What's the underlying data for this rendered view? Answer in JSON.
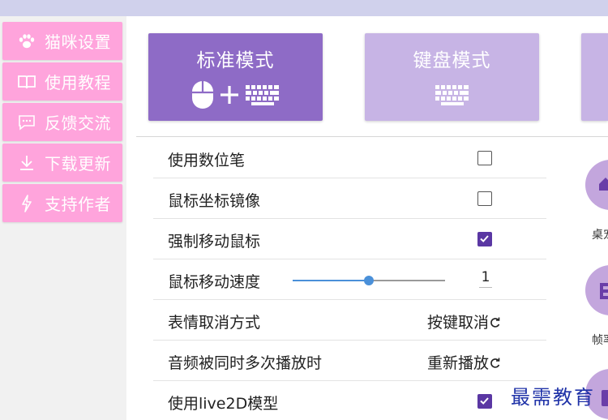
{
  "sidebar": {
    "items": [
      {
        "label": "猫咪设置",
        "icon": "paw-icon"
      },
      {
        "label": "使用教程",
        "icon": "book-icon"
      },
      {
        "label": "反馈交流",
        "icon": "chat-icon"
      },
      {
        "label": "下载更新",
        "icon": "download-icon"
      },
      {
        "label": "支持作者",
        "icon": "bolt-icon"
      }
    ]
  },
  "modes": [
    {
      "label": "标准模式",
      "selected": true,
      "icons": [
        "mouse-icon",
        "plus-icon",
        "keyboard-icon"
      ]
    },
    {
      "label": "键盘模式",
      "selected": false,
      "icons": [
        "keyboard-icon"
      ]
    },
    {
      "label": "",
      "selected": false,
      "icons": []
    }
  ],
  "settings": [
    {
      "label": "使用数位笔",
      "type": "checkbox",
      "checked": false
    },
    {
      "label": "鼠标坐标镜像",
      "type": "checkbox",
      "checked": false
    },
    {
      "label": "强制移动鼠标",
      "type": "checkbox",
      "checked": true
    },
    {
      "label": "鼠标移动速度",
      "type": "slider",
      "value": "1",
      "fraction": 0.5
    },
    {
      "label": "表情取消方式",
      "type": "cycle",
      "value": "按键取消"
    },
    {
      "label": "音频被同时多次播放时",
      "type": "cycle",
      "value": "重新播放"
    },
    {
      "label": "使用live2D模型",
      "type": "checkbox",
      "checked": true
    }
  ],
  "right_panel": [
    {
      "label": "桌宠",
      "icon": "home-icon"
    },
    {
      "label": "帧率",
      "icon": "grid-icon"
    },
    {
      "label": "",
      "icon": "partial-icon"
    }
  ],
  "watermark": "最需教育",
  "colors": {
    "topbar": "#d0d1ec",
    "sidebar_item": "#ffa4dc",
    "mode_selected": "#8e6bc6",
    "mode_unselected": "#c7b4e5",
    "checkbox_on": "#5a37a3",
    "slider": "#4a90d9",
    "right_circle": "#c3a6dd",
    "watermark": "#2033a8"
  }
}
